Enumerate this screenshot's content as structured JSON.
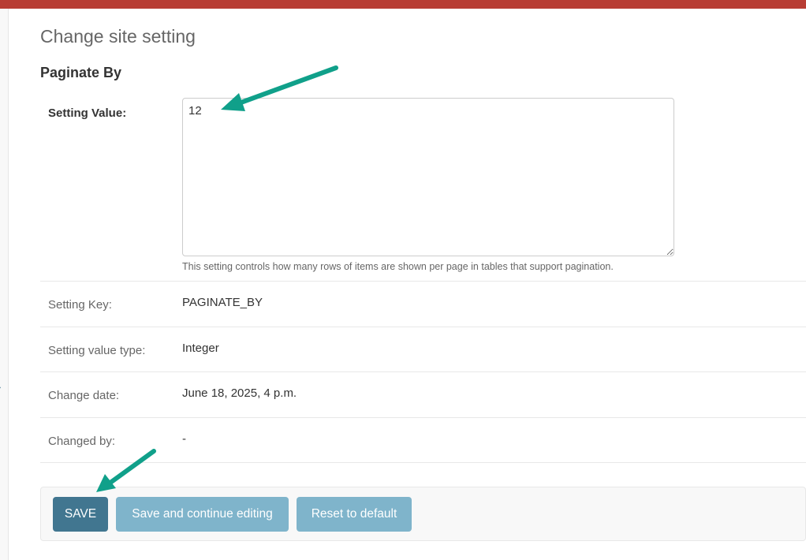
{
  "page": {
    "title": "Change site setting",
    "section_title": "Paginate By"
  },
  "form": {
    "setting_value": {
      "label": "Setting Value:",
      "value": "12",
      "help_text": "This setting controls how many rows of items are shown per page in tables that support pagination."
    },
    "readonly_fields": [
      {
        "label": "Setting Key:",
        "value": "PAGINATE_BY"
      },
      {
        "label": "Setting value type:",
        "value": "Integer"
      },
      {
        "label": "Change date:",
        "value": "June 18, 2025, 4 p.m."
      },
      {
        "label": "Changed by:",
        "value": "-"
      }
    ]
  },
  "buttons": {
    "save": "SAVE",
    "save_continue": "Save and continue editing",
    "reset": "Reset to default"
  },
  "colors": {
    "header_bar": "#b83d34",
    "primary_button": "#417690",
    "secondary_button": "#7fb4cb",
    "annotation_arrow": "#10a08a"
  },
  "icons": {
    "sidebar_toggle": "chevron-right-icon",
    "annotation": "arrow-icon"
  }
}
